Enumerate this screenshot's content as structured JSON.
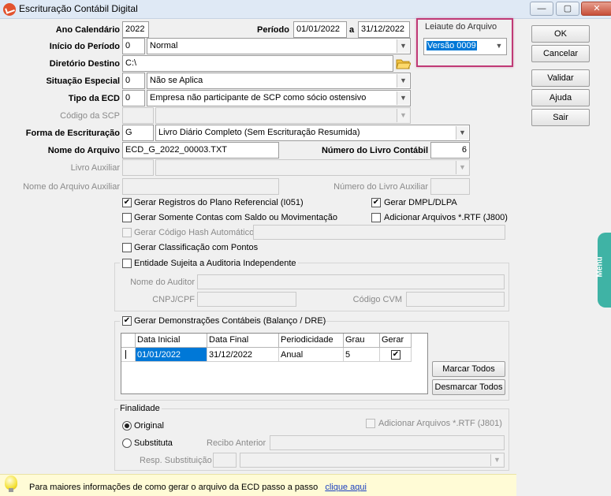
{
  "window": {
    "title": "Escrituração Contábil Digital",
    "minimize": "—",
    "restore": "▢",
    "close": "✕"
  },
  "form": {
    "ano_calendario": {
      "label": "Ano Calendário",
      "value": "2022"
    },
    "periodo": {
      "label": "Período",
      "from": "01/01/2022",
      "sep": "a",
      "to": "31/12/2022"
    },
    "inicio_periodo": {
      "label": "Início do Período",
      "code": "0",
      "value": "Normal"
    },
    "diretorio_destino": {
      "label": "Diretório Destino",
      "value": "C:\\"
    },
    "situacao_especial": {
      "label": "Situação Especial",
      "code": "0",
      "value": "Não se Aplica"
    },
    "tipo_ecd": {
      "label": "Tipo da ECD",
      "code": "0",
      "value": "Empresa não participante de SCP como sócio ostensivo"
    },
    "codigo_scp": {
      "label": "Código da SCP",
      "code": "",
      "value": ""
    },
    "forma_escrituracao": {
      "label": "Forma de Escrituração",
      "code": "G",
      "value": "Livro Diário Completo (Sem Escrituração Resumida)"
    },
    "nome_arquivo": {
      "label": "Nome do Arquivo",
      "value": "ECD_G_2022_00003.TXT"
    },
    "numero_livro": {
      "label": "Número do Livro Contábil",
      "value": "6"
    },
    "livro_auxiliar": {
      "label": "Livro Auxiliar",
      "code": "",
      "value": ""
    },
    "nome_arquivo_auxiliar": {
      "label": "Nome do Arquivo Auxiliar",
      "value": ""
    },
    "numero_livro_auxiliar": {
      "label": "Número do Livro Auxiliar",
      "value": ""
    }
  },
  "leiaute": {
    "legend": "Leiaute do Arquivo",
    "value": "Versão 0009"
  },
  "buttons": {
    "ok": "OK",
    "cancelar": "Cancelar",
    "validar": "Validar",
    "ajuda": "Ajuda",
    "sair": "Sair",
    "marcar_todos": "Marcar Todos",
    "desmarcar_todos": "Desmarcar Todos"
  },
  "options": {
    "gerar_registros_referencial": {
      "label": "Gerar Registros do Plano Referencial (I051)",
      "checked": true
    },
    "gerar_dmpl": {
      "label": "Gerar DMPL/DLPA",
      "checked": true
    },
    "somente_contas_saldo": {
      "label": "Gerar Somente Contas com Saldo ou Movimentação",
      "checked": false
    },
    "adicionar_rtf_j800": {
      "label": "Adicionar Arquivos *.RTF (J800)",
      "checked": false
    },
    "codigo_hash": {
      "label": "Gerar Código Hash Automático",
      "checked": false
    },
    "classificacao_pontos": {
      "label": "Gerar Classificação com Pontos",
      "checked": false
    },
    "auditoria": {
      "label": "Entidade Sujeita a Auditoria Independente",
      "checked": false
    }
  },
  "auditoria": {
    "nome_auditor": {
      "label": "Nome do Auditor",
      "value": ""
    },
    "cnpj_cpf": {
      "label": "CNPJ/CPF",
      "value": ""
    },
    "codigo_cvm": {
      "label": "Código CVM",
      "value": ""
    }
  },
  "demonstracoes": {
    "label": "Gerar Demonstrações Contábeis (Balanço / DRE)",
    "checked": true,
    "columns": [
      "Data Inicial",
      "Data Final",
      "Periodicidade",
      "Grau",
      "Gerar"
    ],
    "rows": [
      {
        "data_inicial": "01/01/2022",
        "data_final": "31/12/2022",
        "periodicidade": "Anual",
        "grau": "5",
        "gerar": true
      }
    ]
  },
  "finalidade": {
    "legend": "Finalidade",
    "original": "Original",
    "substituta": "Substituta",
    "selected": "Original",
    "adicionar_rtf_j801": "Adicionar Arquivos *.RTF (J801)",
    "recibo_anterior": "Recibo Anterior",
    "resp_substituicao": "Resp. Substituição"
  },
  "footer": {
    "text": "Para maiores informações de como gerar o arquivo da ECD passo a passo",
    "link": "clique aqui"
  },
  "side_tab": {
    "label": "Menu"
  },
  "colors": {
    "highlight": "#0078d7",
    "leiaute_border": "#c03a76",
    "menu_tab": "#3fb3a5",
    "footer_bg": "#fffbd6"
  }
}
